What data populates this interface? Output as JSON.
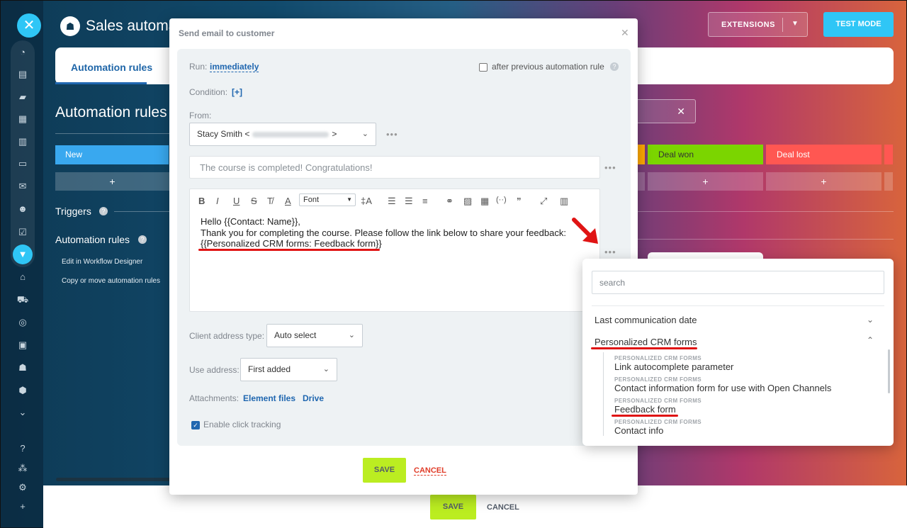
{
  "app": {
    "title": "Sales automa"
  },
  "header": {
    "extensions_label": "EXTENSIONS",
    "test_mode_label": "TEST MODE"
  },
  "background": {
    "tab_active": "Automation rules",
    "heading": "Automation rules",
    "stages": {
      "new": "New",
      "won": "Deal won",
      "lost": "Deal lost",
      "plus": "+"
    },
    "triggers_label": "Triggers",
    "rules_label": "Automation rules",
    "links": [
      "Edit in Workflow Designer",
      "Copy or move automation rules"
    ],
    "save_label": "SAVE",
    "cancel_label": "CANCEL"
  },
  "dialog": {
    "title": "Send email to customer",
    "run_label": "Run:",
    "run_value": "immediately",
    "after_prev_label": "after previous automation rule",
    "condition_label": "Condition:",
    "condition_value": "[+]",
    "from_label": "From:",
    "from_value": "Stacy Smith <",
    "from_value_end": ">",
    "subject": "The course is completed! Congratulations!",
    "font_label": "Font",
    "body_lines": [
      "Hello {{Contact: Name}},",
      "Thank you for completing the course. Please follow the link below to share your feedback:",
      "{{Personalized CRM forms: Feedback form}}"
    ],
    "client_address_label": "Client address type:",
    "client_address_value": "Auto select",
    "use_address_label": "Use address:",
    "use_address_value": "First added",
    "attachments_label": "Attachments:",
    "attachments_links": [
      "Element files",
      "Drive"
    ],
    "click_tracking_label": "Enable click tracking",
    "save_label": "SAVE",
    "cancel_label": "CANCEL"
  },
  "popup": {
    "search_placeholder": "search",
    "sections": [
      {
        "label": "Last communication date",
        "expanded": false
      },
      {
        "label": "Personalized CRM forms",
        "expanded": true
      }
    ],
    "items": [
      {
        "group": "PERSONALIZED CRM FORMS",
        "label": "Link autocomplete parameter"
      },
      {
        "group": "PERSONALIZED CRM FORMS",
        "label": "Contact information form for use with Open Channels"
      },
      {
        "group": "PERSONALIZED CRM FORMS",
        "label": "Feedback form"
      },
      {
        "group": "PERSONALIZED CRM FORMS",
        "label": "Contact info"
      }
    ]
  },
  "colors": {
    "accent": "#2fc6f6",
    "link": "#2067b0",
    "save": "#bbed21",
    "annotation": "#e01414"
  }
}
